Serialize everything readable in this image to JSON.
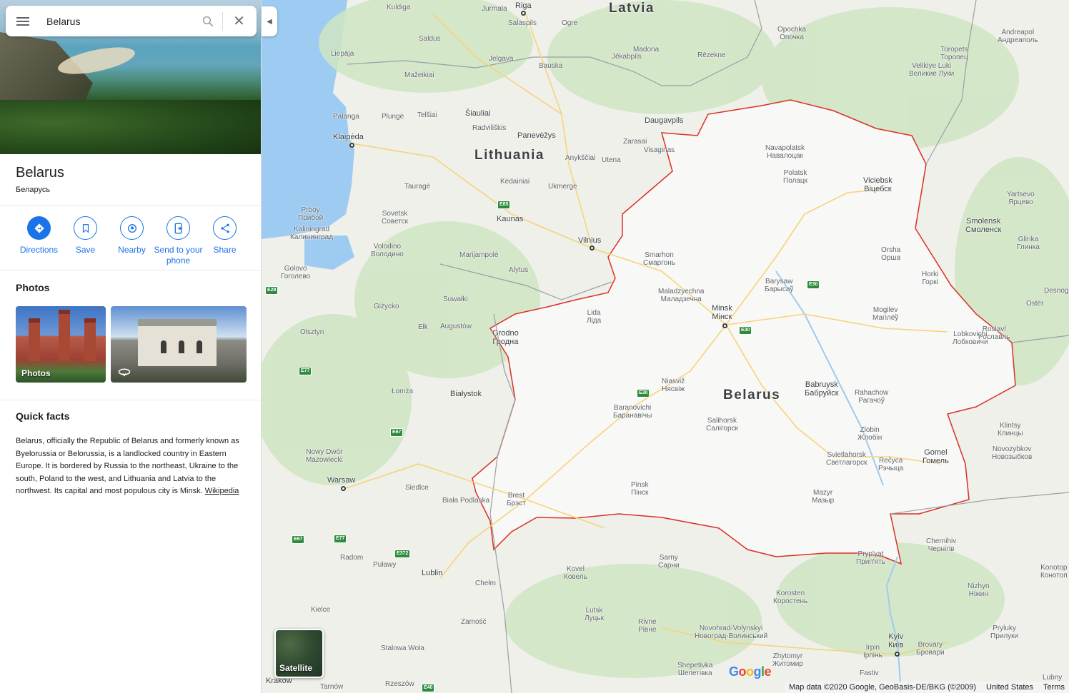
{
  "search": {
    "value": "Belarus",
    "placeholder": "Search Google Maps"
  },
  "place": {
    "title": "Belarus",
    "subtitle": "Беларусь"
  },
  "actions": [
    {
      "label": "Directions",
      "icon": "directions-icon"
    },
    {
      "label": "Save",
      "icon": "bookmark-icon"
    },
    {
      "label": "Nearby",
      "icon": "nearby-icon"
    },
    {
      "label": "Send to your phone",
      "icon": "send-to-phone-icon"
    },
    {
      "label": "Share",
      "icon": "share-icon"
    }
  ],
  "photos": {
    "heading": "Photos",
    "items": [
      {
        "caption": "Photos"
      },
      {
        "caption": ""
      }
    ]
  },
  "quick_facts": {
    "heading": "Quick facts",
    "text": "Belarus, officially the Republic of Belarus and formerly known as Byelorussia or Belorussia, is a landlocked country in Eastern Europe. It is bordered by Russia to the northeast, Ukraine to the south, Poland to the west, and Lithuania and Latvia to the northwest. Its capital and most populous city is Minsk.",
    "link": "Wikipedia"
  },
  "map": {
    "countries": [
      "Latvia",
      "Lithuania",
      "Belarus"
    ],
    "cities": [
      "Kuldiga",
      "Jurmala",
      "Riga",
      "Salaspils",
      "Ogre",
      "Saldus",
      "Jelgava",
      "Bauska",
      "Madona",
      "Liepāja",
      "Jēkabpils",
      "Rēzekne",
      "Mažeikiai",
      "Palanga",
      "Plungė",
      "Telšiai",
      "Šiauliai",
      "Radviliškis",
      "Panevėžys",
      "Daugavpils",
      "Klaipėda",
      "Zarasai",
      "Anykščiai",
      "Utena",
      "Visaginas",
      "Tauragė",
      "Kėdainiai",
      "Ukmergė",
      "Kaunas",
      "Vilnius",
      "Marijampolė",
      "Alytus",
      "Kaliningrad\nКалининград",
      "Sovetsk\nСоветск",
      "Volodino\nВолодино",
      "Golovo\nГоголево",
      "Suwałki",
      "Giżycko",
      "Ełk",
      "Augustów",
      "Olsztyn",
      "Grodno\nГродна",
      "Lida\nЛіда",
      "Smarhon\nСмаргонь",
      "Maladzyechna\nМаладзечна",
      "Navapolatsk\nНавалоцак",
      "Polatsk\nПолацк",
      "Viciebsk\nВіцебск",
      "Barysaw\nБарысаў",
      "Minsk\nМінск",
      "Orsha\nОрша",
      "Mogilev\nМагілёў",
      "Horki\nГоркі",
      "Białystok",
      "Łomża",
      "Niasviž\nНясвіж",
      "Baranovichi\nБаранавічы",
      "Belarus",
      "Babruysk\nБабруйск",
      "Rahachow\nРагачоў",
      "Salihorsk\nСалігорск",
      "Zlobin\nЖлобін",
      "Svietlahorsk\nСветлагорск",
      "Rečyca\nРэчыца",
      "Gomel\nГомель",
      "Nowy Dwór\nMazowiecki",
      "Warsaw",
      "Siedlce",
      "Biała Podlaska",
      "Brest\nБрэст",
      "Pinsk\nПінск",
      "Mazyr\nМазыр",
      "Sarny\nСарни",
      "Kovel\nКовель",
      "Chełm",
      "Lublin",
      "Radom",
      "Puławy",
      "Kielce",
      "Zamość",
      "Lutsk\nЛуцьк",
      "Rivne\nРівне",
      "Korosten\nКоростень",
      "Novohrad-Volynskyi\nНовоград-Волинський",
      "Zhytomyr\nЖитомир",
      "Kyiv\nКиїв",
      "Brovary\nБровари",
      "Irpin\nІрпінь",
      "Chernihiv\nЧернігів",
      "Nizhyn\nНіжин",
      "Pryluky\nПрилуки",
      "Smolensk\nСмоленск",
      "Yartsevo\nЯрцево",
      "Roslavl\nРославль",
      "Velikiye Luki\nВеликие Луки",
      "Toropets\nТоропец",
      "Andreapol\nАндреаполь",
      "Opochka\nОпочка",
      "Glinka\nГлинка",
      "Klintsy\nКлинцы",
      "Novozybkov\nНовозыбков",
      "Konotop\nКонотоп",
      "Lubny",
      "Fastiv",
      "Shepetivka\nШепетівка",
      "Stalowa Wola",
      "Rzeszów",
      "Kraków",
      "Tarnów",
      "Pryp'yat\nПрип'ять",
      "Prboy\nПрибой",
      "Lobkovichi\nЛобковичи",
      "Ostёr",
      "Desnogorsk"
    ],
    "road_shields": [
      "E85",
      "E28",
      "E77",
      "E67",
      "E30",
      "E30",
      "E30",
      "E67",
      "E77",
      "E372",
      "E40"
    ]
  },
  "satellite_label": "Satellite",
  "footer": {
    "attribution": "Map data ©2020 Google, GeoBasis-DE/BKG (©2009)",
    "region": "United States",
    "terms": "Terms"
  },
  "colors": {
    "accent": "#1a73e8",
    "border": "#d93025",
    "land": "#eef0e9",
    "water": "#9ecbf2"
  }
}
